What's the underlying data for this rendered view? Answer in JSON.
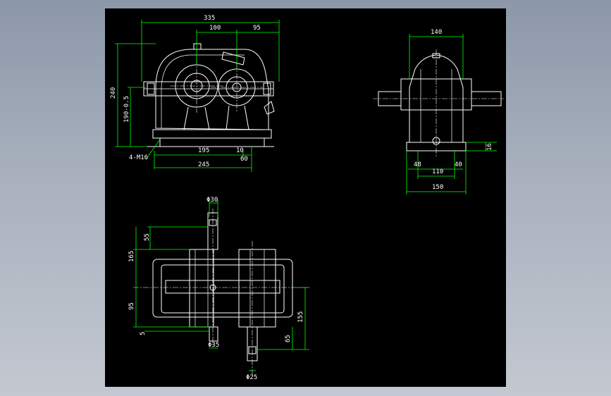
{
  "colors": {
    "background": "#a9b1be",
    "sheet": "#000000",
    "outline": "#ffffff",
    "dimension_line": "#00ff00"
  },
  "front_view": {
    "dim_overall_width": "335",
    "dim_center_left": "100",
    "dim_center_right": "95",
    "dim_height": "240",
    "dim_shaft_height": "190-0.5",
    "dim_foot_bolt_spacing": "195",
    "dim_foot_gap": "10",
    "dim_foot_offset": "60",
    "dim_base_length": "245",
    "label_bolts": "4-M16"
  },
  "side_view": {
    "dim_top_width": "140",
    "dim_base_thickness": "16",
    "dim_left_foot": "48",
    "dim_right_foot": "40",
    "dim_bolt_spacing": "110",
    "dim_base_width": "150"
  },
  "top_view": {
    "dim_input_shaft_dia": "Φ30",
    "dim_input_shaft_len": "55",
    "dim_input_extent": "165",
    "dim_lower_extent": "95",
    "dim_small_offset": "5",
    "dim_output_extent": "155",
    "dim_output_shaft_len": "65",
    "dim_output_shaft_dia_1": "Φ35",
    "dim_output_shaft_dia_2": "Φ25"
  }
}
